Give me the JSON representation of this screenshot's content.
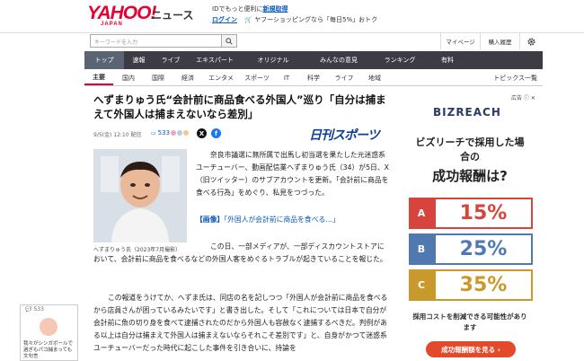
{
  "header": {
    "logo_text": "YAHOO!",
    "logo_sub": "JAPAN",
    "section": "ニュース",
    "promo_prefix": "IDでもっと便利に",
    "promo_link": "新規取得",
    "login": "ログイン",
    "shopping": "ヤフーショッピングなら「毎日5%」おトク"
  },
  "search": {
    "placeholder": "キーワードを入力",
    "links": [
      "マイページ",
      "購入履歴"
    ]
  },
  "nav_primary": [
    "トップ",
    "速報",
    "ライブ",
    "エキスパート",
    "オリジナル",
    "みんなの意見",
    "ランキング",
    "有料"
  ],
  "nav_secondary": [
    "主要",
    "国内",
    "国際",
    "経済",
    "エンタメ",
    "スポーツ",
    "IT",
    "科学",
    "ライフ",
    "地域"
  ],
  "nav_more": "トピックス一覧",
  "article": {
    "title": "へずまりゅう氏“会計前に商品食べる外国人”巡り「自分は捕まえて外国人は捕まえないなら差別」",
    "date": "9/5(金) 12:10 配信",
    "comments": "533",
    "source": "日刊スポーツ",
    "photo_caption": "へずまりゅう氏（2023年7月撮影）",
    "p1": "奈良市議選に無所属で出馬し初当選を果たした元迷惑系ユーチューバー、動画配信業へずまりゅう氏（34）が5日、X（旧ツイッター）のサブアカウントを更新。「会計前に商品を食べる行為」をめぐり、私見をつづった。",
    "related_tag": "【画像】",
    "related_text": "「外国人が会計前に商品を食べる…」",
    "p2a": "この日、一部メディアが、一部ディスカウントストアにおいて、会計前に商品を食べるなどの外国人客をめぐるトラブルが起きていることを報じた。",
    "p3": "この報道をうけてか、へずま氏は、同店の名を記しつつ「外国人が会計前に商品を食べるから店員さんが困っているみたいです」と書き出した。そして「これについては日本で自分が会計前に魚の切り身を食べて逮捕されたのだから外国人も容赦なく逮捕するべきだ。判例がある以上は自分は捕まえて外国人は捕まえないならそれこそ差別です」と、自身がかつて迷惑系ユーチューバーだった時代に起こした事件を引き合いに、持論を"
  },
  "ad": {
    "tag": "広告",
    "brand": "BIZREACH",
    "headline": "ビズリーチで採用した場合の",
    "big": "成功報酬は?",
    "plans": [
      {
        "label": "A",
        "pct": "15%"
      },
      {
        "label": "B",
        "pct": "25%"
      },
      {
        "label": "C",
        "pct": "35%"
      }
    ],
    "sub": "採用コストを削減できる可能性があります",
    "cta": "成功報酬額を見る"
  },
  "sidebar": {
    "count": "533",
    "snippet": "我々がシンガポールで過ぎもパコ捕まっても文句言"
  },
  "colors": {
    "brand_red": "#e60033",
    "nav_dark": "#3c3c44",
    "plan_a": "#d7443e",
    "plan_b": "#4f79b0",
    "plan_c": "#c99a2b"
  }
}
